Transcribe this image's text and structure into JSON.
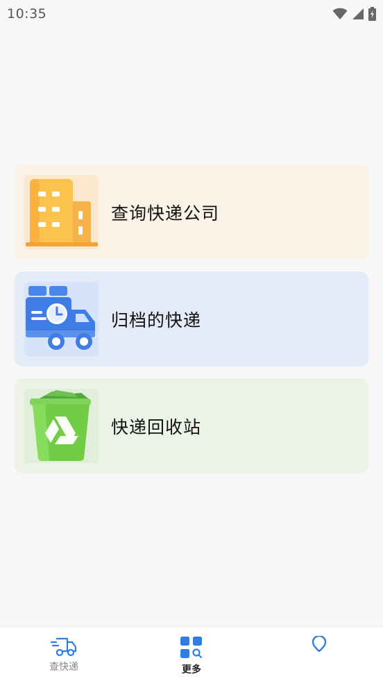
{
  "status_bar": {
    "time": "10:35"
  },
  "menu": {
    "items": [
      {
        "label": "查询快递公司",
        "bg": "#faf1e7",
        "icon_bg": "#fbe8cc",
        "icon": "building-icon"
      },
      {
        "label": "归档的快递",
        "bg": "#e4ebf8",
        "icon_bg": "#d7e3fb",
        "icon": "delivery-truck-icon"
      },
      {
        "label": "快递回收站",
        "bg": "#ecf3e6",
        "icon_bg": "#e0eeda",
        "icon": "recycle-bin-icon"
      }
    ]
  },
  "bottom_nav": {
    "items": [
      {
        "label": "查快递",
        "icon": "truck-icon",
        "active": false
      },
      {
        "label": "更多",
        "icon": "grid-search-icon",
        "active": true
      },
      {
        "label": "",
        "icon": "location-pin-icon",
        "active": false
      }
    ],
    "active_color": "#2f7de1",
    "inactive_color": "#888888"
  }
}
